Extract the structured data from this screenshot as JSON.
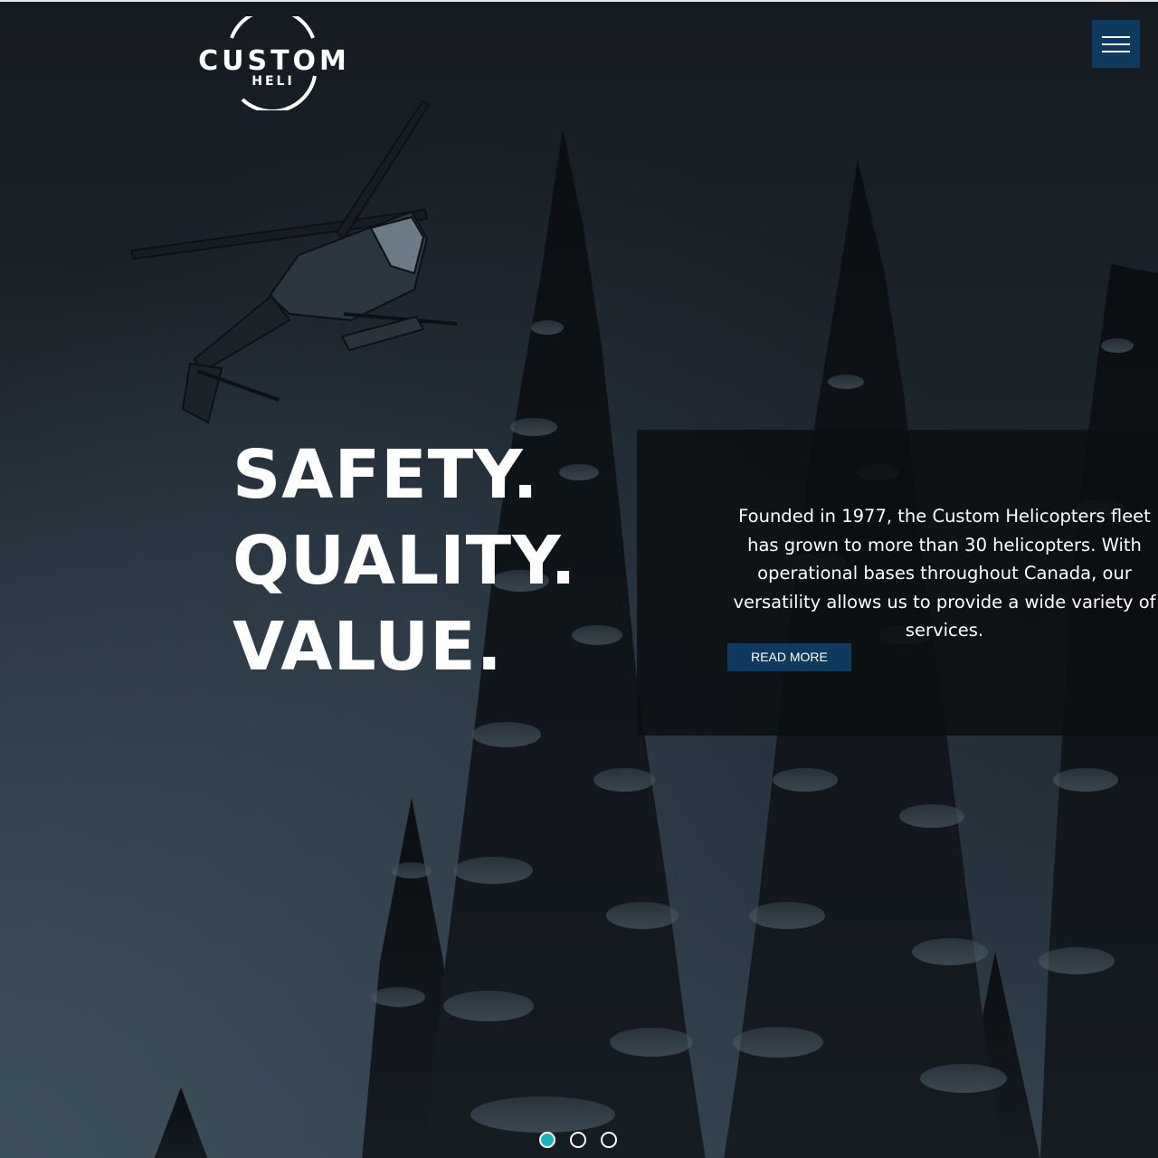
{
  "brand": {
    "logo_word": "CUSTOM",
    "logo_sub": "HELI",
    "primary_color": "#0d3a5e",
    "accent_color": "#17b5bf"
  },
  "header": {
    "menu_icon": "hamburger-menu-icon"
  },
  "hero": {
    "headline": [
      "SAFETY.",
      "QUALITY.",
      "VALUE."
    ],
    "description": "Founded in 1977, the Custom Helicopters fleet has grown to more than 30 helicopters. With operational bases throughout Canada, our versatility allows us to provide a wide variety of services.",
    "cta_label": "READ MORE"
  },
  "slider": {
    "slide_count": 3,
    "active_index": 0
  }
}
